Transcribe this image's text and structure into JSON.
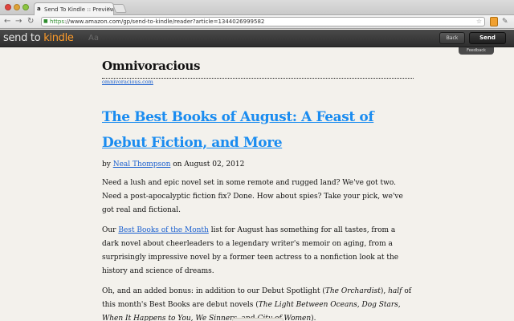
{
  "browser": {
    "tab_title": "Send To Kindle :: Preview",
    "tab_favicon": "a",
    "url_scheme": "https",
    "url_rest": "://www.amazon.com/gp/send-to-kindle/reader?article=1344026999582",
    "icons": [
      "close-window-icon",
      "minimize-icon",
      "zoom-icon",
      "back-arrow-icon",
      "forward-arrow-icon",
      "reload-icon",
      "lock-icon",
      "star-icon",
      "extension-icon",
      "wrench-icon"
    ]
  },
  "appbar": {
    "logo_main": "send to ",
    "logo_accent": "kindle",
    "font_toggle": "Aa",
    "back_label": "Back",
    "send_label": "Send",
    "feedback_label": "Feedback"
  },
  "article": {
    "site_name": "Omnivoracious",
    "site_link": "omnivoracious.com",
    "headline": "The Best Books of August: A Feast of Debut Fiction, and More",
    "byline_prefix": "by ",
    "author": "Neal Thompson",
    "byline_suffix": " on August 02, 2012",
    "p1": "Need a lush and epic novel set in some remote and rugged land? We've got two. Need a post-apocalyptic fiction fix? Done. How about spies? Take your pick, we've got real and fictional.",
    "p2_prefix": "Our ",
    "p2_link": "Best Books of the Month",
    "p2_suffix": " list for August has something for all tastes, from a dark novel about cheerleaders to a legendary writer's memoir on aging, from a surprisingly impressive novel by a former teen actress to a nonfiction look at the history and science of dreams.",
    "p3_a": "Oh, and an added bonus: in addition to our Debut Spotlight (",
    "p3_b": "The Orchardist",
    "p3_c": "), ",
    "p3_d": "half",
    "p3_e": " of this month's Best Books are debut novels (",
    "p3_f": "The Light Between Oceans, Dog Stars, When It Happens to You, We Sinners,",
    "p3_g": " and ",
    "p3_h": "City of Women",
    "p3_i": ")."
  }
}
